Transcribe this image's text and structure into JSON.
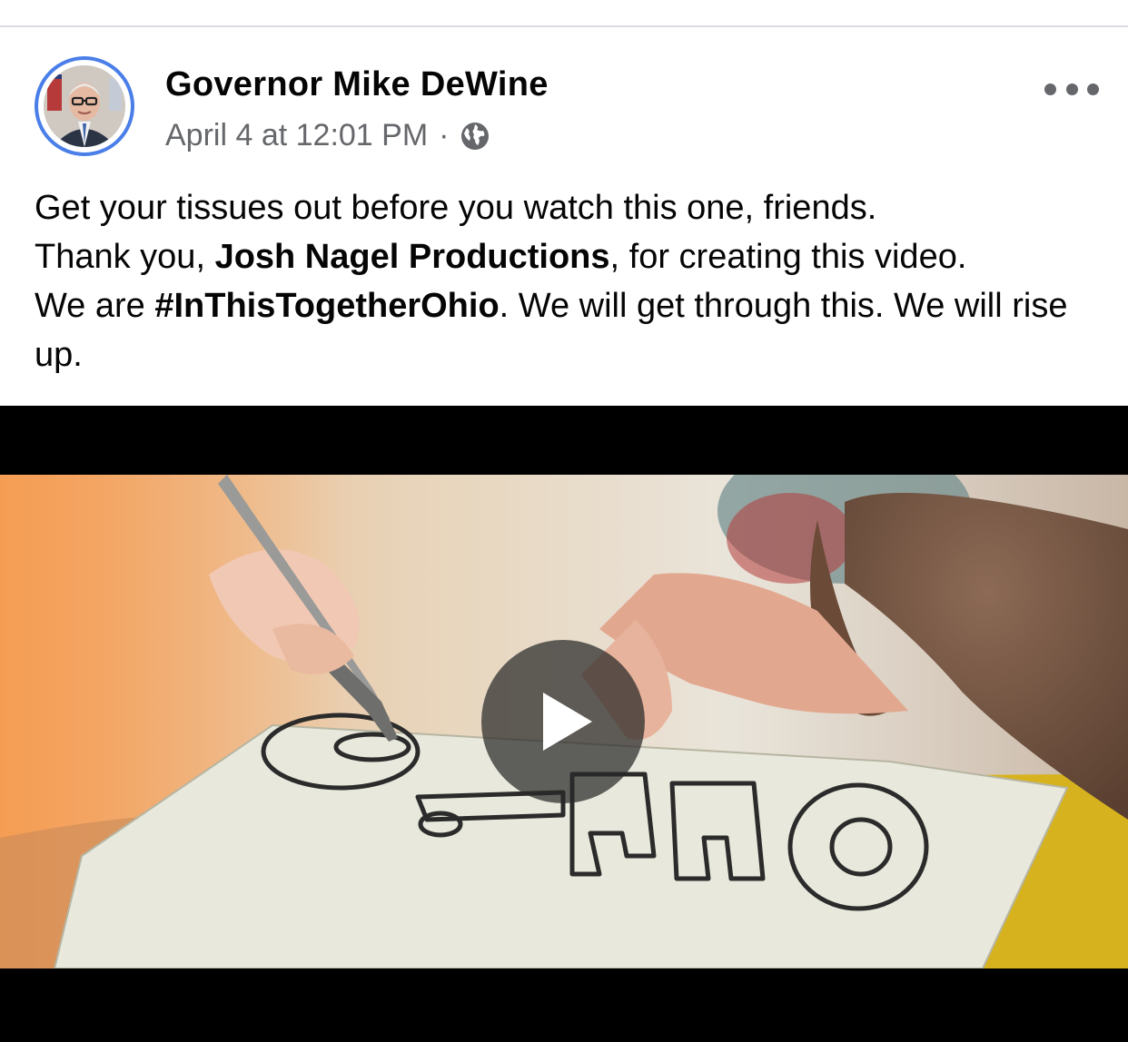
{
  "post": {
    "author": "Governor Mike DeWine",
    "timestamp": "April 4 at 12:01 PM",
    "separator": "·",
    "privacy_icon": "globe-icon",
    "more_icon": "more-options-icon",
    "text": {
      "line1": "Get your tissues out before you watch this one, friends.",
      "thanks_prefix": "Thank you, ",
      "mention": "Josh Nagel Productions",
      "thanks_suffix": ", for creating this video.",
      "we_are": "We are ",
      "hashtag": "#InThisTogetherOhio",
      "closing": ". We will get through this. We will rise up."
    }
  },
  "video": {
    "drawn_word": "Ohio!",
    "play_icon": "play-icon"
  },
  "colors": {
    "avatar_ring": "#4a7ee8",
    "meta_text": "#65676b",
    "letterbox": "#000000",
    "table_yellow": "#d6b31e"
  }
}
